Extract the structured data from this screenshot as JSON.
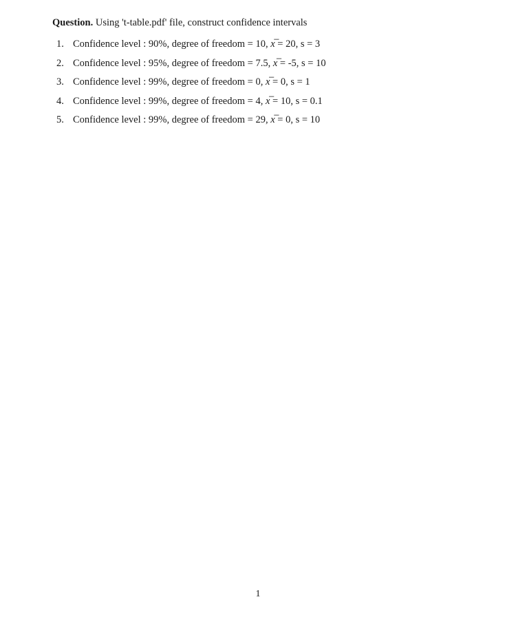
{
  "question": {
    "label": "Question.",
    "text": "Using 't-table.pdf' file, construct confidence intervals"
  },
  "items": [
    {
      "num": "1.",
      "prefix": "Confidence level : 90%, degree of freedom = 10,  ",
      "xbar": "x",
      "suffix": "  = 20, s = 3"
    },
    {
      "num": "2.",
      "prefix": "Confidence level : 95%, degree of freedom = 7.5,  ",
      "xbar": "x",
      "suffix": "  = -5, s = 10"
    },
    {
      "num": "3.",
      "prefix": "Confidence level : 99%, degree of freedom = 0,  ",
      "xbar": "x",
      "suffix": "  = 0, s = 1"
    },
    {
      "num": "4.",
      "prefix": "Confidence level : 99%, degree of freedom = 4,  ",
      "xbar": "x",
      "suffix": "  = 10, s = 0.1"
    },
    {
      "num": "5.",
      "prefix": "Confidence level : 99%, degree of freedom = 29,  ",
      "xbar": "x",
      "suffix": "  = 0, s = 10"
    }
  ],
  "pageNumber": "1"
}
